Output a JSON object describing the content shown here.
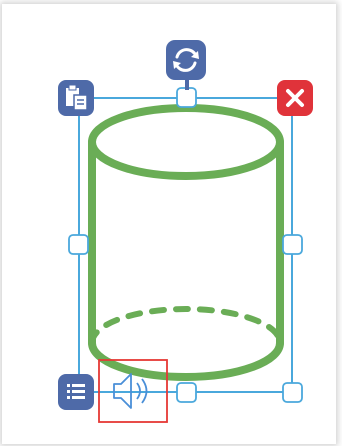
{
  "canvas": {
    "selected_shape": "cylinder"
  },
  "icons": {
    "rotate": "rotate-icon",
    "paste": "clipboard-icon",
    "delete": "close-icon",
    "menu": "list-menu-icon",
    "sound": "speaker-icon"
  },
  "colors": {
    "shape_stroke": "#6aad56",
    "selection": "#4aa8dc",
    "button_fill": "#4e6aa8",
    "delete_fill": "#e0333a",
    "highlight_box": "#e53935",
    "speaker_stroke": "#4a8fd8"
  }
}
